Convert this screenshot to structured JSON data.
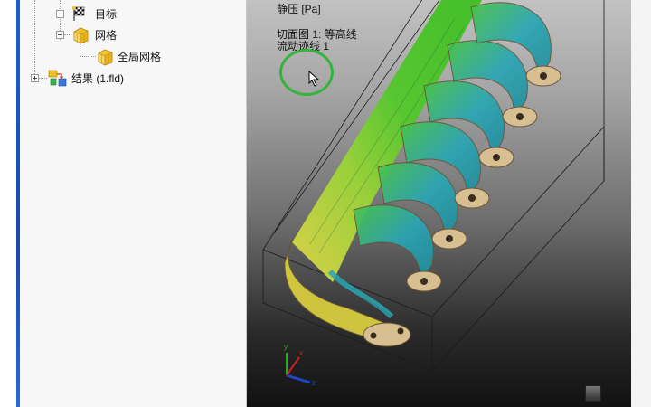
{
  "tree": {
    "items": [
      {
        "label": "目标"
      },
      {
        "label": "网格"
      },
      {
        "label": "全局网格"
      },
      {
        "label": "结果 (1.fld)"
      }
    ]
  },
  "viewport": {
    "title": "静压 [Pa]",
    "lines": [
      "切面图 1: 等高线",
      "流动迹线 1"
    ]
  },
  "colors": {
    "brand_green": "#34b53a",
    "pressure_high": "#e6e048",
    "pressure_mid": "#52c82a",
    "pressure_low": "#2aa6b4"
  }
}
